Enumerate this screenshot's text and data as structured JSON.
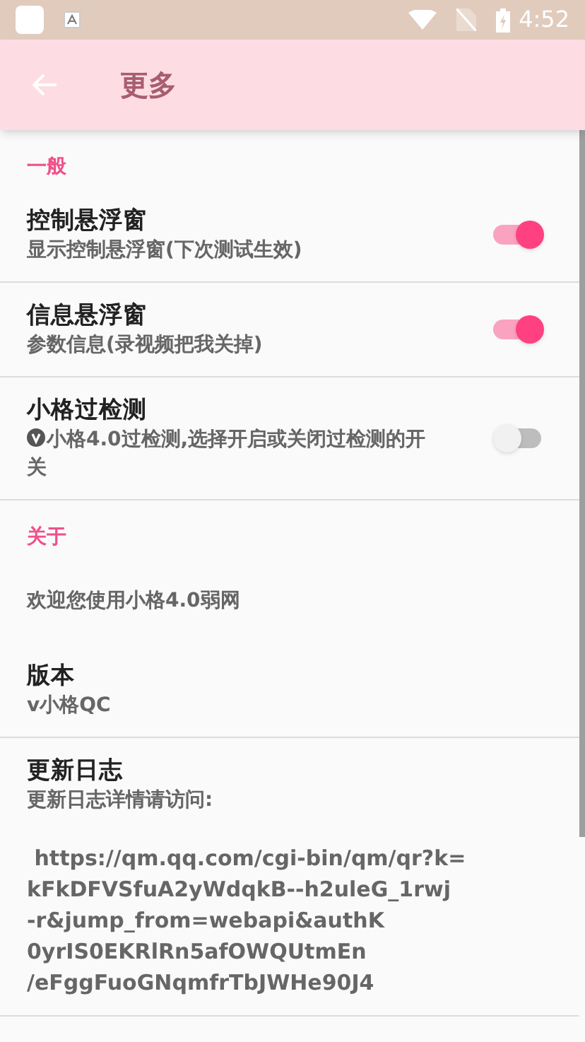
{
  "status_bar": {
    "time": "4:52"
  },
  "app_bar": {
    "title": "更多"
  },
  "sections": [
    {
      "header": "一般",
      "items": [
        {
          "kind": "switch",
          "title": "控制悬浮窗",
          "subtitle": "显示控制悬浮窗(下次测试生效)",
          "on": true
        },
        {
          "kind": "switch",
          "title": "信息悬浮窗",
          "subtitle": "参数信息(录视频把我关掉)",
          "on": true
        },
        {
          "kind": "switch",
          "title": "小格过检测",
          "subtitle": "小格4.0过检测,选择开启或关闭过检测的开关",
          "badge": true,
          "on": false
        }
      ]
    },
    {
      "header": "关于",
      "items": [
        {
          "kind": "text",
          "subtitle": "欢迎您使用小格4.0弱网"
        },
        {
          "kind": "text",
          "title": "版本",
          "subtitle": "v小格QC"
        },
        {
          "kind": "link",
          "title": "更新日志",
          "subtitle": "更新日志详情请访问:",
          "url_lines": [
            " https://qm.qq.com/cgi-bin/qm/qr?k=",
            "kFkDFVSfuA2yWdqkB--h2uleG_1rwj",
            "-r&jump_from=webapi&authK",
            "0yrIS0EKRlRn5afOWQUtmEn",
            "/eFggFuoGNqmfrTbJWHe90J4"
          ]
        }
      ]
    }
  ]
}
